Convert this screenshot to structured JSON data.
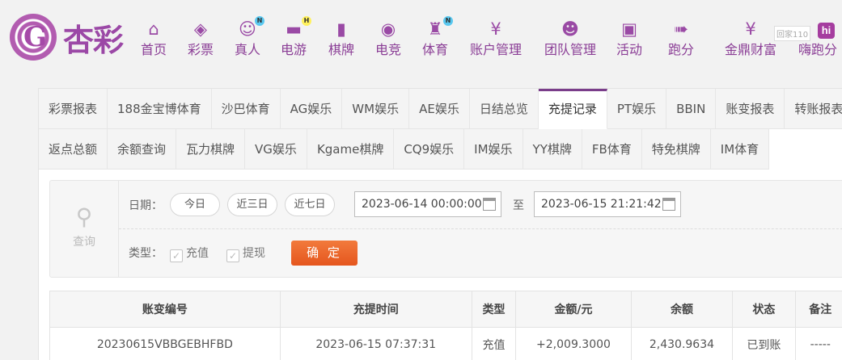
{
  "brand": {
    "name": "杏彩"
  },
  "nav": [
    {
      "label": "首页",
      "icon": "home-icon",
      "glyph": "⌂"
    },
    {
      "label": "彩票",
      "icon": "lottery-ticket-icon",
      "glyph": "◈"
    },
    {
      "label": "真人",
      "icon": "live-dealer-icon",
      "glyph": "☺",
      "badge": "N"
    },
    {
      "label": "电游",
      "icon": "gamepad-icon",
      "glyph": "▬",
      "badge": "H"
    },
    {
      "label": "棋牌",
      "icon": "cards-icon",
      "glyph": "▮"
    },
    {
      "label": "电竞",
      "icon": "esports-controller-icon",
      "glyph": "◉"
    },
    {
      "label": "体育",
      "icon": "trophy-icon",
      "glyph": "♜",
      "badge": "N"
    },
    {
      "label": "账户管理",
      "icon": "yen-coin-icon",
      "glyph": "¥"
    },
    {
      "label": "团队管理",
      "icon": "team-icon",
      "glyph": "☻"
    },
    {
      "label": "活动",
      "icon": "gift-icon",
      "glyph": "▣"
    },
    {
      "label": "跑分",
      "icon": "running-icon",
      "glyph": "➠"
    },
    {
      "label": "金鼎财富",
      "icon": "wealth-icon",
      "glyph": "¥"
    },
    {
      "label": "嗨跑分",
      "icon": "hi-icon",
      "glyph": "hi"
    }
  ],
  "watermark": "回家110",
  "tabs_row1": [
    "彩票报表",
    "188金宝博体育",
    "沙巴体育",
    "AG娱乐",
    "WM娱乐",
    "AE娱乐",
    "日结总览",
    "充提记录",
    "PT娱乐",
    "BBIN",
    "账变报表",
    "转账报表"
  ],
  "tabs_row2": [
    "返点总额",
    "余额查询",
    "瓦力棋牌",
    "VG娱乐",
    "Kgame棋牌",
    "CQ9娱乐",
    "IM娱乐",
    "YY棋牌",
    "FB体育",
    "特免棋牌",
    "IM体育"
  ],
  "active_tab": "充提记录",
  "search": {
    "side_label": "查询",
    "date_label": "日期：",
    "quick_ranges": [
      "今日",
      "近三日",
      "近七日"
    ],
    "start": "2023-06-14 00:00:00",
    "to_label": "至",
    "end": "2023-06-15 21:21:42",
    "type_label": "类型：",
    "types": [
      {
        "label": "充值",
        "checked": true
      },
      {
        "label": "提现",
        "checked": true
      }
    ],
    "confirm": "确 定"
  },
  "table": {
    "headers": [
      "账变编号",
      "充提时间",
      "类型",
      "金额/元",
      "余额",
      "状态",
      "备注"
    ],
    "rows": [
      [
        "20230615VBBGEBHFBD",
        "2023-06-15 07:37:31",
        "充值",
        "+2,009.3000",
        "2,430.9634",
        "已到账",
        "-----"
      ]
    ]
  },
  "colors": {
    "brand_purple": "#9b48a6",
    "confirm_orange": "#e5561e",
    "amount_red": "#cc2222",
    "status_green": "#3a9b2c"
  }
}
